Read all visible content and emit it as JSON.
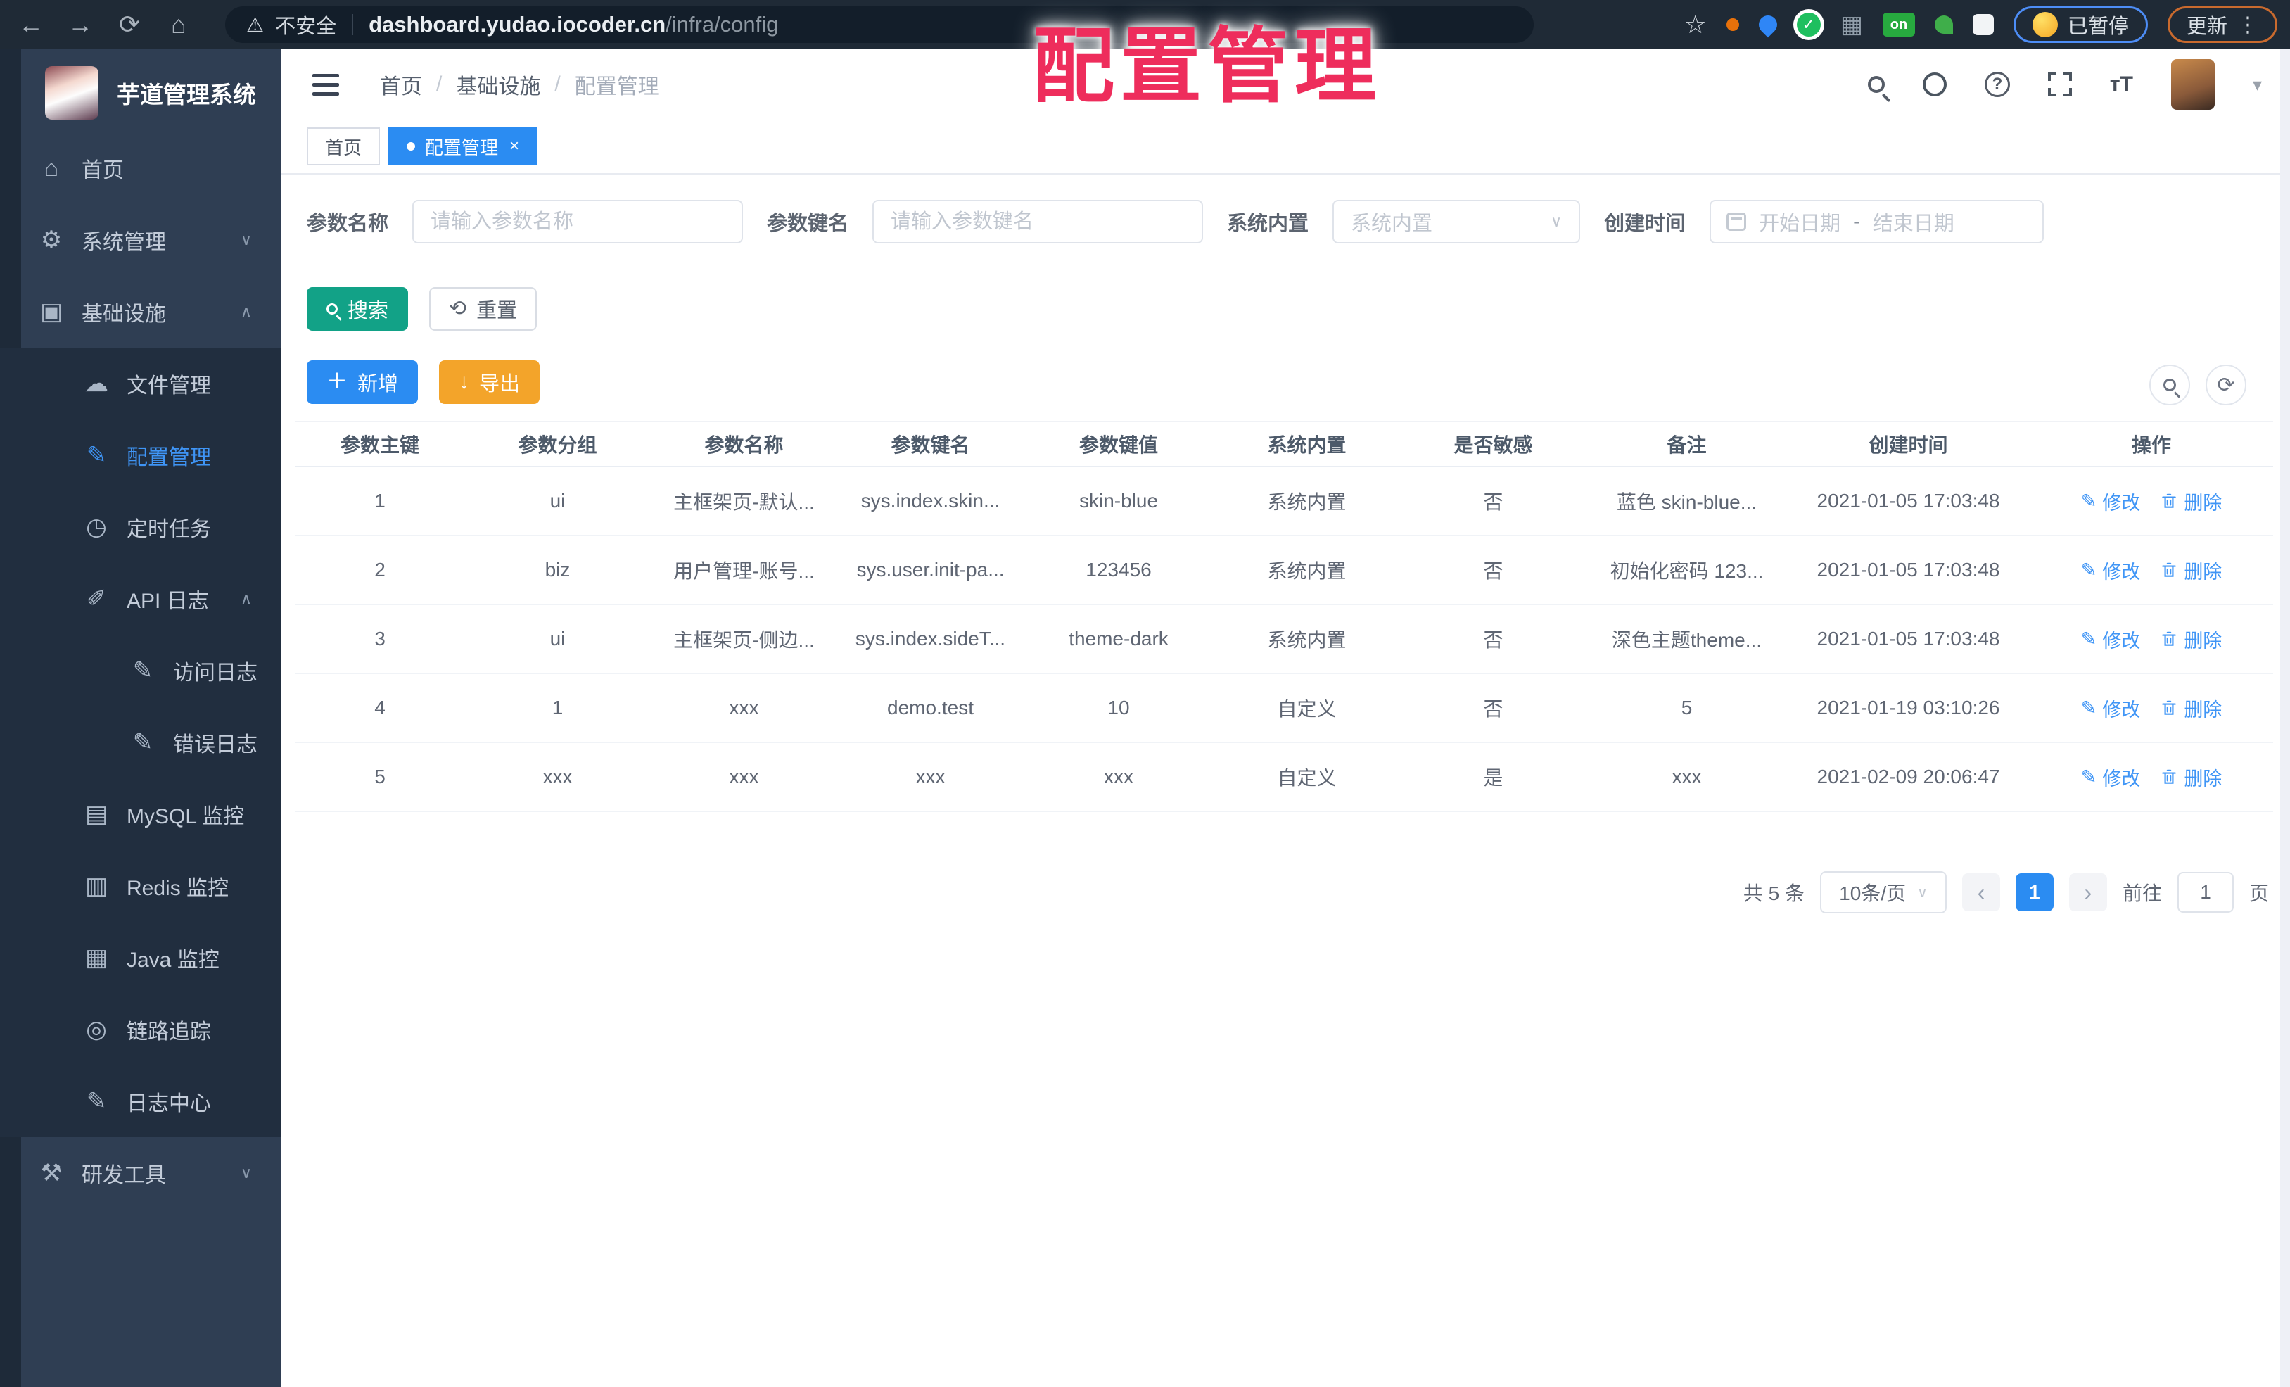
{
  "overlay": {
    "title": "配置管理",
    "color": "#ee2d5c"
  },
  "browser": {
    "security_label": "不安全",
    "url_host": "dashboard.yudao.iocoder.cn",
    "url_path": "/infra/config",
    "extension_on_badge": "on",
    "paused_badge": "已暂停",
    "update_button": "更新"
  },
  "sidebar": {
    "app_title": "芋道管理系统",
    "items": [
      {
        "id": "home",
        "label": "首页",
        "icon": "home-icon",
        "level": 1
      },
      {
        "id": "system-manage",
        "label": "系统管理",
        "icon": "gear-icon",
        "level": 1,
        "chevron": "down"
      },
      {
        "id": "infrastructure",
        "label": "基础设施",
        "icon": "infrastructure-icon",
        "level": 1,
        "chevron": "up"
      },
      {
        "id": "file-manage",
        "label": "文件管理",
        "icon": "file-manage-icon",
        "level": 2,
        "in_section": true
      },
      {
        "id": "config-manage",
        "label": "配置管理",
        "icon": "config-manage-icon",
        "level": 2,
        "in_section": true,
        "active": true
      },
      {
        "id": "scheduled-task",
        "label": "定时任务",
        "icon": "scheduled-task-icon",
        "level": 2,
        "in_section": true
      },
      {
        "id": "api-log",
        "label": "API 日志",
        "icon": "api-log-icon",
        "level": 2,
        "in_section": true,
        "chevron": "up"
      },
      {
        "id": "access-log",
        "label": "访问日志",
        "icon": "access-log-icon",
        "level": 3,
        "in_section": true
      },
      {
        "id": "error-log",
        "label": "错误日志",
        "icon": "error-log-icon",
        "level": 3,
        "in_section": true
      },
      {
        "id": "mysql-monitor",
        "label": "MySQL 监控",
        "icon": "mysql-monitor-icon",
        "level": 2,
        "in_section": true
      },
      {
        "id": "redis-monitor",
        "label": "Redis 监控",
        "icon": "redis-monitor-icon",
        "level": 2,
        "in_section": true
      },
      {
        "id": "java-monitor",
        "label": "Java 监控",
        "icon": "java-monitor-icon",
        "level": 2,
        "in_section": true
      },
      {
        "id": "trace",
        "label": "链路追踪",
        "icon": "trace-icon",
        "level": 2,
        "in_section": true
      },
      {
        "id": "log-center",
        "label": "日志中心",
        "icon": "log-center-icon",
        "level": 2,
        "in_section": true
      },
      {
        "id": "devtools",
        "label": "研发工具",
        "icon": "devtools-icon",
        "level": 1,
        "chevron": "down"
      }
    ]
  },
  "header": {
    "breadcrumb": [
      "首页",
      "基础设施",
      "配置管理"
    ]
  },
  "tabs": [
    {
      "label": "首页",
      "active": false,
      "closable": false
    },
    {
      "label": "配置管理",
      "active": true,
      "closable": true
    }
  ],
  "filters": {
    "name": {
      "label": "参数名称",
      "placeholder": "请输入参数名称"
    },
    "key": {
      "label": "参数键名",
      "placeholder": "请输入参数键名"
    },
    "builtin": {
      "label": "系统内置",
      "placeholder": "系统内置"
    },
    "create_time": {
      "label": "创建时间",
      "start_placeholder": "开始日期",
      "separator": "-",
      "end_placeholder": "结束日期"
    }
  },
  "toolbar": {
    "search": "搜索",
    "reset": "重置",
    "add": "新增",
    "export": "导出"
  },
  "table": {
    "columns": [
      "参数主键",
      "参数分组",
      "参数名称",
      "参数键名",
      "参数键值",
      "系统内置",
      "是否敏感",
      "备注",
      "创建时间",
      "操作"
    ],
    "rows": [
      [
        "1",
        "ui",
        "主框架页-默认...",
        "sys.index.skin...",
        "skin-blue",
        "系统内置",
        "否",
        "蓝色 skin-blue...",
        "2021-01-05 17:03:48"
      ],
      [
        "2",
        "biz",
        "用户管理-账号...",
        "sys.user.init-pa...",
        "123456",
        "系统内置",
        "否",
        "初始化密码 123...",
        "2021-01-05 17:03:48"
      ],
      [
        "3",
        "ui",
        "主框架页-侧边...",
        "sys.index.sideT...",
        "theme-dark",
        "系统内置",
        "否",
        "深色主题theme...",
        "2021-01-05 17:03:48"
      ],
      [
        "4",
        "1",
        "xxx",
        "demo.test",
        "10",
        "自定义",
        "否",
        "5",
        "2021-01-19 03:10:26"
      ],
      [
        "5",
        "xxx",
        "xxx",
        "xxx",
        "xxx",
        "自定义",
        "是",
        "xxx",
        "2021-02-09 20:06:47"
      ]
    ],
    "row_actions": {
      "edit": "修改",
      "delete": "删除"
    }
  },
  "pagination": {
    "total_label": "共 5 条",
    "page_size_label": "10条/页",
    "current_page": "1",
    "goto_label": "前往",
    "goto_value": "1",
    "unit_label": "页"
  }
}
